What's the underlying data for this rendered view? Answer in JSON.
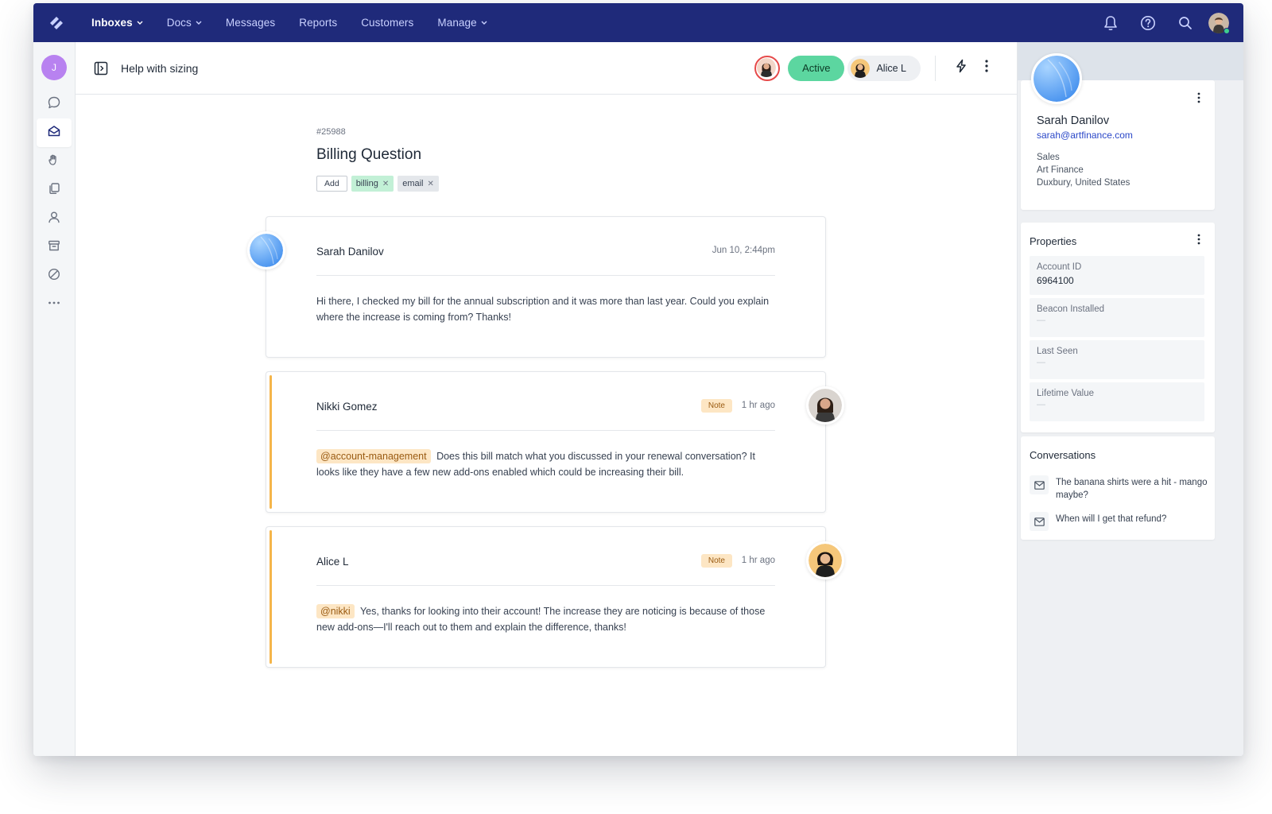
{
  "nav": {
    "items": [
      {
        "label": "Inboxes",
        "dropdown": true,
        "active": true
      },
      {
        "label": "Docs",
        "dropdown": true,
        "active": false
      },
      {
        "label": "Messages",
        "dropdown": false,
        "active": false
      },
      {
        "label": "Reports",
        "dropdown": false,
        "active": false
      },
      {
        "label": "Customers",
        "dropdown": false,
        "active": false
      },
      {
        "label": "Manage",
        "dropdown": true,
        "active": false
      }
    ],
    "icons": [
      "bell-icon",
      "help-icon",
      "search-icon"
    ]
  },
  "sidebar": {
    "avatar_initial": "J",
    "icons": [
      "chat-bubble-icon",
      "inbox-icon",
      "hand-icon",
      "documents-icon",
      "person-icon",
      "archive-icon",
      "block-icon",
      "more-icon"
    ]
  },
  "conversation": {
    "subject": "Help with sizing",
    "status": "Active",
    "assignee": "Alice L",
    "ticket_number": "#25988",
    "title": "Billing Question",
    "add_tag_label": "Add",
    "tags": [
      {
        "label": "billing",
        "color": "#c2f0d6"
      },
      {
        "label": "email",
        "color": "#e4e7eb"
      }
    ]
  },
  "threads": [
    {
      "author": "Sarah Danilov",
      "time": "Jun 10, 2:44pm",
      "type": "message",
      "mention": "",
      "body": "Hi there, I checked my bill for the annual subscription and it was more than last year. Could you explain where the increase is coming from? Thanks!"
    },
    {
      "author": "Nikki Gomez",
      "time": "1 hr ago",
      "type": "note",
      "badge": "Note",
      "mention": "@account-management",
      "body": "Does this bill match what you discussed in your renewal conversation? It looks like they have a few new add-ons enabled which could be increasing their bill."
    },
    {
      "author": "Alice L",
      "time": "1 hr ago",
      "type": "note",
      "badge": "Note",
      "mention": "@nikki",
      "body": "Yes, thanks for looking into their account! The increase they are noticing is because of those new add-ons—I'll reach out to them and explain the difference, thanks!"
    }
  ],
  "customer": {
    "name": "Sarah Danilov",
    "email": "sarah@artfinance.com",
    "department": "Sales",
    "company": "Art Finance",
    "location": "Duxbury, United States"
  },
  "properties": {
    "title": "Properties",
    "items": [
      {
        "label": "Account ID",
        "value": "6964100"
      },
      {
        "label": "Beacon Installed",
        "value": "—"
      },
      {
        "label": "Last Seen",
        "value": "—"
      },
      {
        "label": "Lifetime Value",
        "value": "—"
      }
    ]
  },
  "conversations_panel": {
    "title": "Conversations",
    "items": [
      {
        "text": "The banana shirts were a hit - mango maybe?"
      },
      {
        "text": "When will I get that refund?"
      }
    ]
  },
  "colors": {
    "nav_bg": "#1f2a7a",
    "status_active": "#5cd6a0",
    "note_accent": "#f5b54a",
    "link": "#2a47c8"
  }
}
